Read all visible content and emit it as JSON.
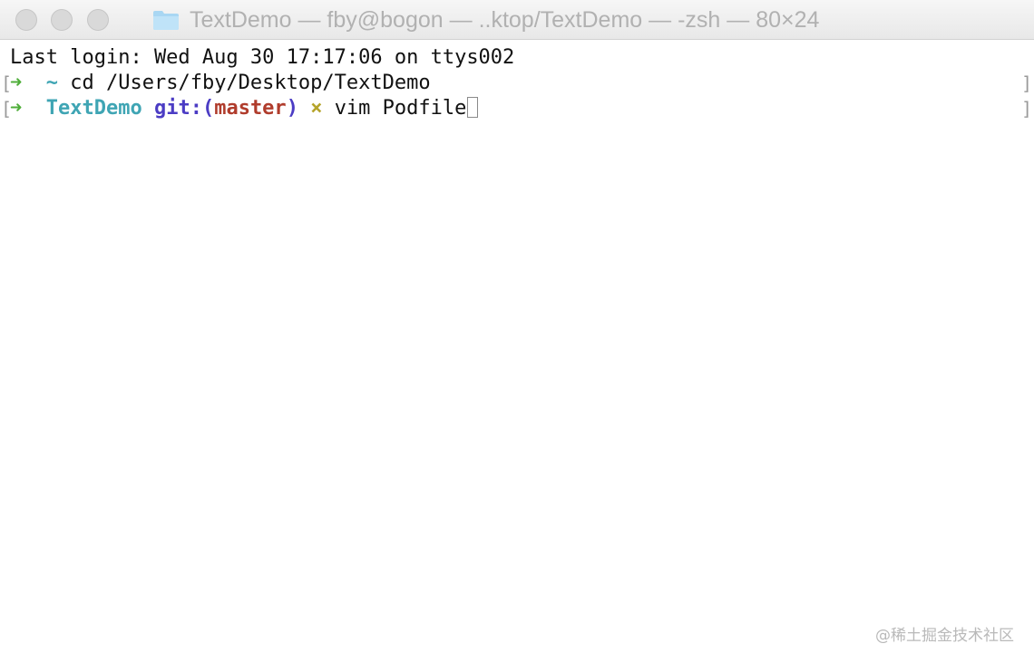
{
  "window": {
    "title": "TextDemo — fby@bogon — ..ktop/TextDemo — -zsh — 80×24",
    "title_icon": "folder-icon",
    "buttons": [
      "close",
      "minimize",
      "zoom"
    ]
  },
  "terminal": {
    "line1": "Last login: Wed Aug 30 17:17:06 on ttys002",
    "line2": {
      "mark_left": "[",
      "arrow": "➜",
      "cwd": "~",
      "command": "cd /Users/fby/Desktop/TextDemo",
      "mark_right": "]"
    },
    "line3": {
      "mark_left": "[",
      "arrow": "➜",
      "cwd": "TextDemo",
      "git_prefix": "git:(",
      "branch": "master",
      "git_suffix": ")",
      "dirty_marker": "×",
      "command": "vim Podfile",
      "mark_right": "]"
    }
  },
  "colors": {
    "arrow": "#4fae3a",
    "cwd": "#3fa5b4",
    "git": "#4b3cc4",
    "branch": "#b03c2c",
    "dirty": "#b5a42b"
  },
  "watermark": "@稀土掘金技术社区"
}
